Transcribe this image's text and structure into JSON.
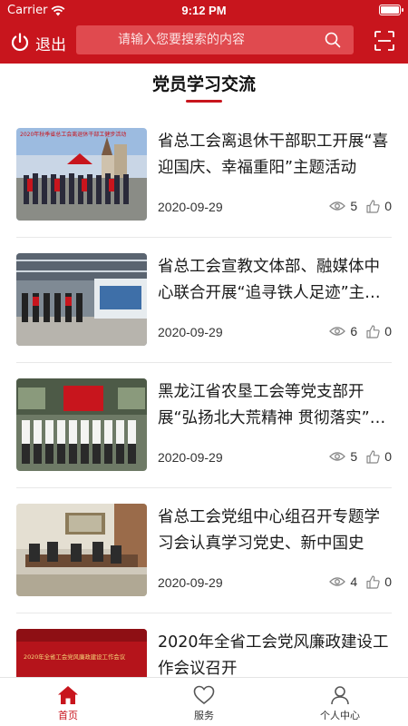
{
  "status_bar": {
    "carrier": "Carrier",
    "time": "9:12 PM"
  },
  "header": {
    "exit_label": "退出",
    "search_placeholder": "请输入您要搜索的内容"
  },
  "section_title": "党员学习交流",
  "articles": [
    {
      "title": "省总工会离退休干部职工开展“喜迎国庆、幸福重阳”主题活动",
      "date": "2020-09-29",
      "views": "5",
      "likes": "0",
      "banner": "2020年秋季省总工会离退休干部工健步活动"
    },
    {
      "title": "省总工会宣教文体部、融媒体中心联合开展“追寻铁人足迹”主题党日活动",
      "date": "2020-09-29",
      "views": "6",
      "likes": "0"
    },
    {
      "title": "黑龙江省农垦工会等党支部开展“弘扬北大荒精神 贯彻落实”主题活动",
      "date": "2020-09-29",
      "views": "5",
      "likes": "0"
    },
    {
      "title": "省总工会党组中心组召开专题学习会认真学习党史、新中国史",
      "date": "2020-09-29",
      "views": "4",
      "likes": "0"
    },
    {
      "title": "2020年全省工会党风廉政建设工作会议召开",
      "date": "",
      "views": "",
      "likes": "",
      "banner": "2020年全省工会党风廉政建设工作会议"
    }
  ],
  "tabbar": {
    "home": "首页",
    "service": "服务",
    "profile": "个人中心"
  },
  "colors": {
    "brand": "#c8151d"
  }
}
